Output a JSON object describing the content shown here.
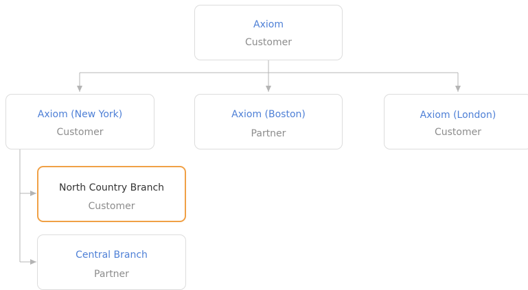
{
  "org_chart": {
    "root": {
      "name": "Axiom",
      "type": "Customer"
    },
    "children": [
      {
        "name": "Axiom (New York)",
        "type": "Customer",
        "children": [
          {
            "name": "North Country Branch",
            "type": "Customer",
            "selected": true
          },
          {
            "name": "Central Branch",
            "type": "Partner"
          }
        ]
      },
      {
        "name": "Axiom (Boston)",
        "type": "Partner"
      },
      {
        "name": "Axiom (London)",
        "type": "Customer"
      }
    ]
  },
  "colors": {
    "name_text": "#4d7fd6",
    "type_text": "#8c8c8c",
    "selected_border": "#f0a045",
    "connector": "#b4b4b4"
  }
}
